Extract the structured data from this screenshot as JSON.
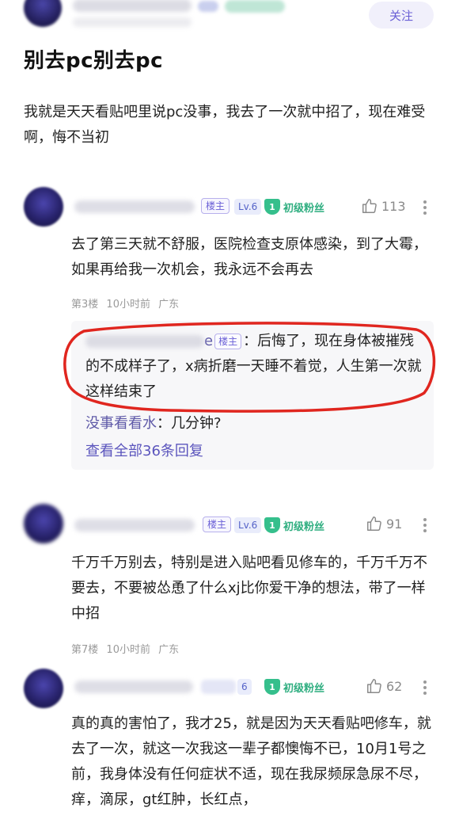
{
  "header": {
    "follow_label": "关注"
  },
  "post": {
    "title": "别去pc别去pc",
    "body": "我就是天天看贴吧里说pc没事，我去了一次就中招了，现在难受啊，悔不当初"
  },
  "comments": [
    {
      "author_blurred": "SwordHeartTime",
      "owner_tag": "楼主",
      "level": "Lv.6",
      "fan_level": "1",
      "fan_label": "初级粉丝",
      "likes": "113",
      "text": "去了第三天就不舒服，医院检查支原体感染，到了大霉，如果再给我一次机会，我永远不会再去",
      "floor": "第3楼",
      "time": "10小时前",
      "location": "广东",
      "replies": {
        "owner_reply_suffix": "e",
        "owner_tag": "楼主",
        "owner_reply_text": "：后悔了，现在身体被摧残的不成样子了，x病折磨一天睡不着觉，人生第一次就这样结束了",
        "other_user": "没事看看水",
        "other_text": "：几分钟?",
        "view_all": "查看全部36条回复"
      }
    },
    {
      "owner_tag": "楼主",
      "level": "Lv.6",
      "fan_level": "1",
      "fan_label": "初级粉丝",
      "likes": "91",
      "text": "千万千万别去，特别是进入贴吧看见修车的，千万千万不要去，不要被怂恿了什么xj比你爱干净的想法，带了一样中招",
      "floor": "第7楼",
      "time": "10小时前",
      "location": "广东"
    },
    {
      "author_blurred": "SwordHeartTime",
      "level": "6",
      "fan_level": "1",
      "fan_label": "初级粉丝",
      "likes": "62",
      "text": "真的真的害怕了，我才25，就是因为天天看贴吧修车，就去了一次，就这一次我这一辈子都懊悔不已，10月1号之前，我身体没有任何症状不适，现在我尿频尿急尿不尽，痒，滴尿，gt红肿，长红点，"
    }
  ]
}
